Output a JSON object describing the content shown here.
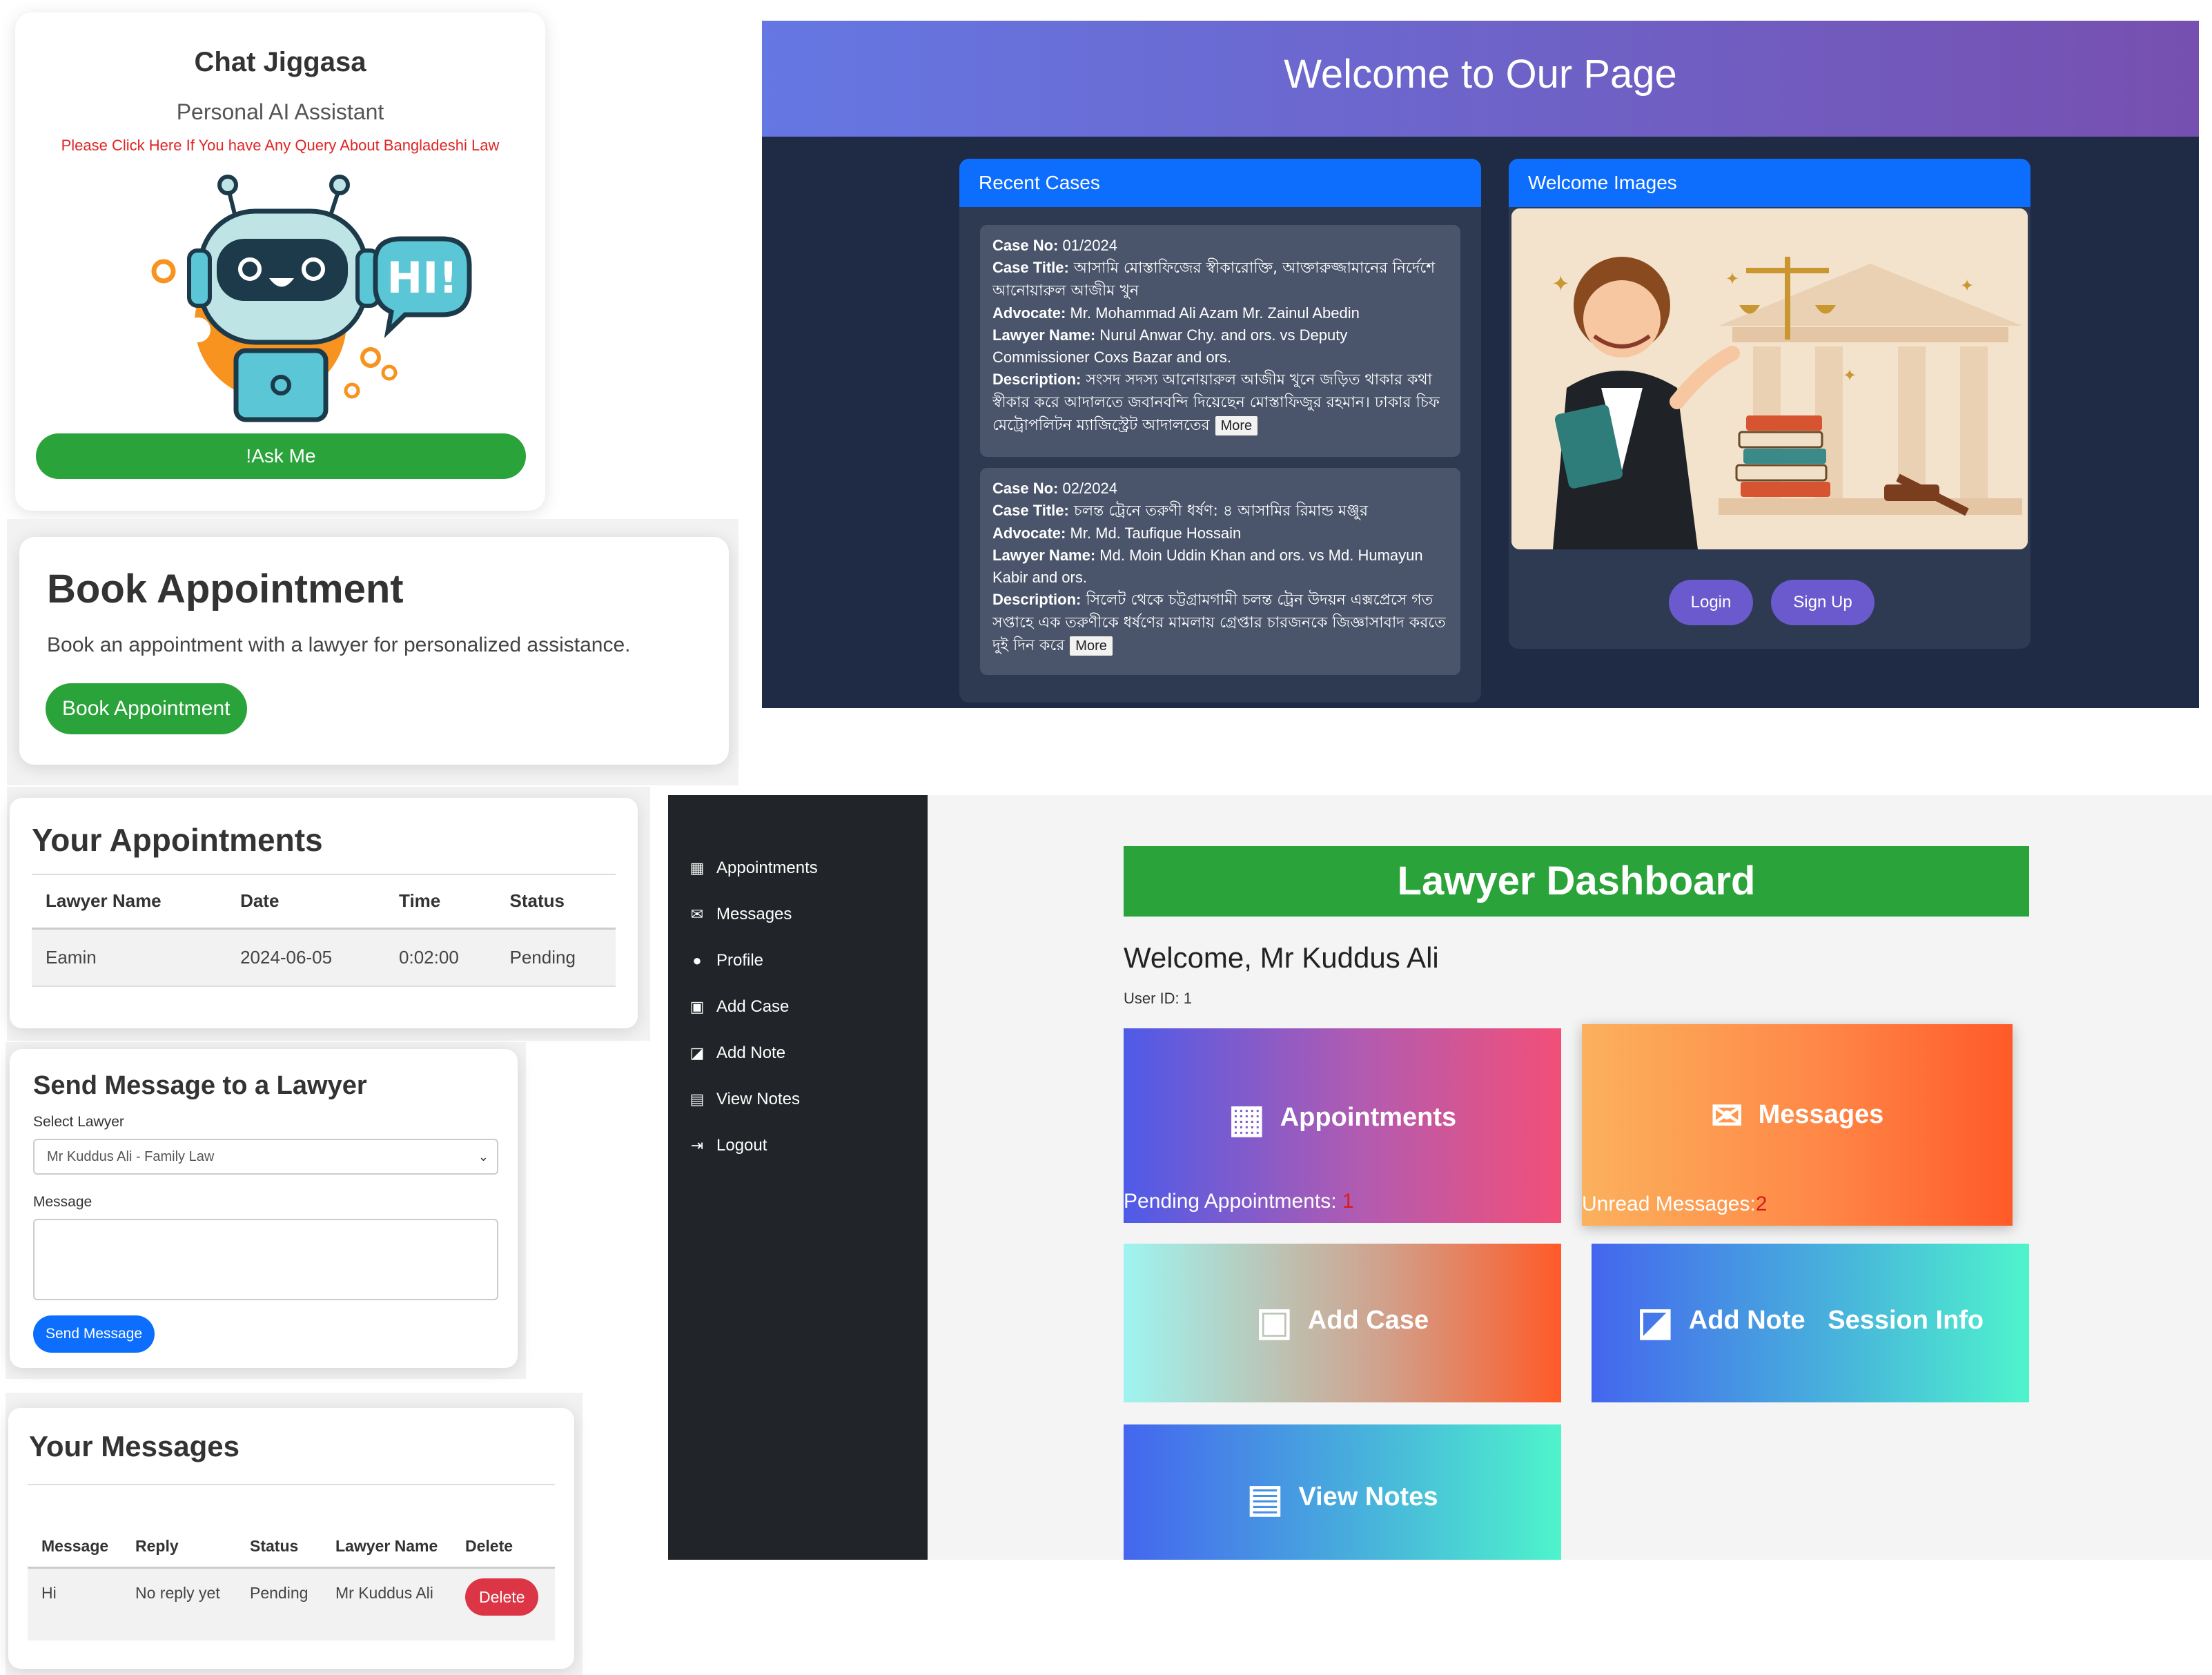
{
  "chat": {
    "title": "Chat Jiggasa",
    "subtitle": "Personal AI Assistant",
    "link": "Please Click Here If You have Any Query About Bangladeshi Law",
    "bubble": "HI!",
    "ask_button": "!Ask Me"
  },
  "book": {
    "title": "Book Appointment",
    "description": "Book an appointment with a lawyer for personalized assistance.",
    "button": "Book Appointment"
  },
  "appointments": {
    "title": "Your Appointments",
    "headers": [
      "Lawyer Name",
      "Date",
      "Time",
      "Status"
    ],
    "rows": [
      [
        "Eamin",
        "2024-06-05",
        "0:02:00",
        "Pending"
      ]
    ]
  },
  "send_message": {
    "title": "Send Message to a Lawyer",
    "select_label": "Select Lawyer",
    "select_value": "Mr Kuddus Ali - Family Law",
    "message_label": "Message",
    "button": "Send Message"
  },
  "your_messages": {
    "title": "Your Messages",
    "headers": [
      "Message",
      "Reply",
      "Status",
      "Lawyer Name",
      "Delete"
    ],
    "row": {
      "message": "Hi",
      "reply": "No reply yet",
      "status": "Pending",
      "lawyer": "Mr Kuddus Ali",
      "delete_button": "Delete"
    }
  },
  "welcome": {
    "title": "Welcome to Our Page",
    "recent_cases_heading": "Recent Cases",
    "images_heading": "Welcome Images",
    "labels": {
      "case_no": "Case No:",
      "case_title": "Case Title:",
      "advocate": "Advocate:",
      "lawyer_name": "Lawyer Name:",
      "description": "Description:"
    },
    "cases": [
      {
        "case_no": " 01/2024",
        "case_title": " আসামি মোস্তাফিজের স্বীকারোক্তি, আক্তারুজ্জামানের নির্দেশে আনোয়ারুল আজীম খুন",
        "advocate": " Mr. Mohammad Ali Azam Mr. Zainul Abedin",
        "lawyer_name": " Nurul Anwar Chy. and ors. vs Deputy Commissioner Coxs Bazar and ors.",
        "description": " সংসদ সদস্য আনোয়ারুল আজীম খুনে জড়িত থাকার কথা স্বীকার করে আদালতে জবানবন্দি দিয়েছেন মোস্তাফিজুর রহমান। ঢাকার চিফ মেট্রোপলিটন ম্যাজিস্ট্রেট আদালতের ",
        "more": "More"
      },
      {
        "case_no": " 02/2024",
        "case_title": " চলন্ত ট্রেনে তরুণী ধর্ষণ: ৪ আসামির রিমান্ড মঞ্জুর",
        "advocate": " Mr. Md. Taufique Hossain",
        "lawyer_name": " Md. Moin Uddin Khan and ors. vs Md. Humayun Kabir and ors.",
        "description": " সিলেট থেকে চট্টগ্রামগামী চলন্ত ট্রেন উদয়ন এক্সপ্রেসে গত সপ্তাহে এক তরুণীকে ধর্ষণের মামলায় গ্রেপ্তার চারজনকে জিজ্ঞাসাবাদ করতে দুই দিন করে ",
        "more": "More"
      }
    ],
    "login_button": "Login",
    "signup_button": "Sign Up"
  },
  "dashboard": {
    "sidebar": [
      {
        "label": "Appointments",
        "icon": "calendar-icon"
      },
      {
        "label": "Messages",
        "icon": "envelope-icon"
      },
      {
        "label": "Profile",
        "icon": "user-icon"
      },
      {
        "label": "Add Case",
        "icon": "briefcase-icon"
      },
      {
        "label": "Add Note",
        "icon": "note-icon"
      },
      {
        "label": "View Notes",
        "icon": "book-icon"
      },
      {
        "label": "Logout",
        "icon": "logout-icon"
      }
    ],
    "title": "Lawyer Dashboard",
    "welcome": "Welcome, Mr Kuddus Ali",
    "user_id": "User ID: 1",
    "tiles": {
      "appointments": "Appointments",
      "pending_label": "Pending Appointments: ",
      "pending_count": "1",
      "messages": "Messages",
      "unread_label": "Unread Messages:",
      "unread_count": "2",
      "add_case": "Add Case",
      "add_note": "Add Note",
      "session_info": "Session Info",
      "view_notes": "View Notes"
    }
  }
}
